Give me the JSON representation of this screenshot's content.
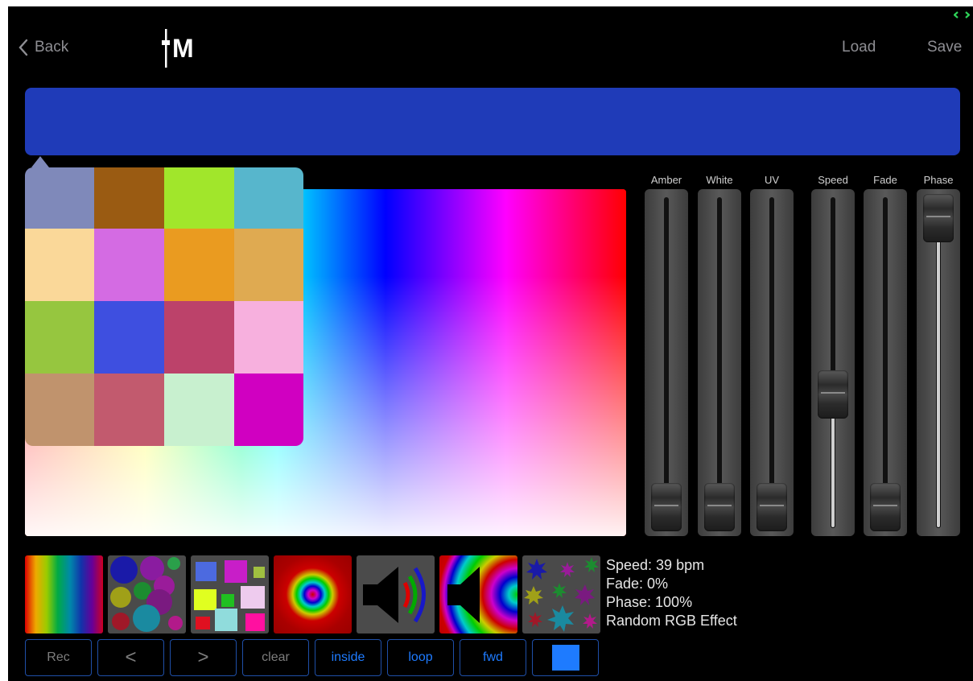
{
  "nav": {
    "back_label": "Back",
    "logo_text": "M",
    "load_label": "Load",
    "save_label": "Save"
  },
  "color_bar": {
    "color": "#1f3bb8"
  },
  "palette": {
    "swatches": [
      "#7f89ba",
      "#9a5b12",
      "#a1e62b",
      "#57b6cc",
      "#fad899",
      "#d46be3",
      "#ea9b20",
      "#dfaa51",
      "#96c63f",
      "#3e4fe0",
      "#bc426a",
      "#f7b0de",
      "#c0936d",
      "#c25a6e",
      "#c8f0cf",
      "#d000c1"
    ]
  },
  "sliders": [
    {
      "label": "Amber",
      "value": 0.0
    },
    {
      "label": "White",
      "value": 0.0
    },
    {
      "label": "UV",
      "value": 0.0
    },
    {
      "label": "Speed",
      "value": 0.39
    },
    {
      "label": "Fade",
      "value": 0.0
    },
    {
      "label": "Phase",
      "value": 1.0
    }
  ],
  "info": {
    "speed": "Speed: 39 bpm",
    "fade": "Fade: 0%",
    "phase": "Phase: 100%",
    "effect": "Random RGB Effect"
  },
  "buttons": {
    "rec": "Rec",
    "prev": "<",
    "next": ">",
    "clear": "clear",
    "inside": "inside",
    "loop": "loop",
    "fwd": "fwd"
  },
  "accent_color": "#1e7bff"
}
